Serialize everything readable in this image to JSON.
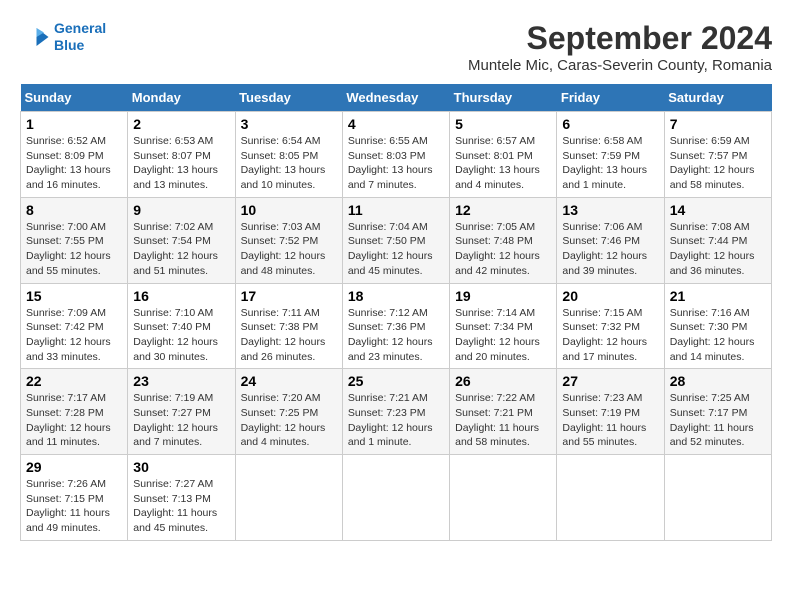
{
  "logo": {
    "line1": "General",
    "line2": "Blue"
  },
  "title": "September 2024",
  "subtitle": "Muntele Mic, Caras-Severin County, Romania",
  "days_of_week": [
    "Sunday",
    "Monday",
    "Tuesday",
    "Wednesday",
    "Thursday",
    "Friday",
    "Saturday"
  ],
  "weeks": [
    [
      {
        "day": "1",
        "info": "Sunrise: 6:52 AM\nSunset: 8:09 PM\nDaylight: 13 hours\nand 16 minutes."
      },
      {
        "day": "2",
        "info": "Sunrise: 6:53 AM\nSunset: 8:07 PM\nDaylight: 13 hours\nand 13 minutes."
      },
      {
        "day": "3",
        "info": "Sunrise: 6:54 AM\nSunset: 8:05 PM\nDaylight: 13 hours\nand 10 minutes."
      },
      {
        "day": "4",
        "info": "Sunrise: 6:55 AM\nSunset: 8:03 PM\nDaylight: 13 hours\nand 7 minutes."
      },
      {
        "day": "5",
        "info": "Sunrise: 6:57 AM\nSunset: 8:01 PM\nDaylight: 13 hours\nand 4 minutes."
      },
      {
        "day": "6",
        "info": "Sunrise: 6:58 AM\nSunset: 7:59 PM\nDaylight: 13 hours\nand 1 minute."
      },
      {
        "day": "7",
        "info": "Sunrise: 6:59 AM\nSunset: 7:57 PM\nDaylight: 12 hours\nand 58 minutes."
      }
    ],
    [
      {
        "day": "8",
        "info": "Sunrise: 7:00 AM\nSunset: 7:55 PM\nDaylight: 12 hours\nand 55 minutes."
      },
      {
        "day": "9",
        "info": "Sunrise: 7:02 AM\nSunset: 7:54 PM\nDaylight: 12 hours\nand 51 minutes."
      },
      {
        "day": "10",
        "info": "Sunrise: 7:03 AM\nSunset: 7:52 PM\nDaylight: 12 hours\nand 48 minutes."
      },
      {
        "day": "11",
        "info": "Sunrise: 7:04 AM\nSunset: 7:50 PM\nDaylight: 12 hours\nand 45 minutes."
      },
      {
        "day": "12",
        "info": "Sunrise: 7:05 AM\nSunset: 7:48 PM\nDaylight: 12 hours\nand 42 minutes."
      },
      {
        "day": "13",
        "info": "Sunrise: 7:06 AM\nSunset: 7:46 PM\nDaylight: 12 hours\nand 39 minutes."
      },
      {
        "day": "14",
        "info": "Sunrise: 7:08 AM\nSunset: 7:44 PM\nDaylight: 12 hours\nand 36 minutes."
      }
    ],
    [
      {
        "day": "15",
        "info": "Sunrise: 7:09 AM\nSunset: 7:42 PM\nDaylight: 12 hours\nand 33 minutes."
      },
      {
        "day": "16",
        "info": "Sunrise: 7:10 AM\nSunset: 7:40 PM\nDaylight: 12 hours\nand 30 minutes."
      },
      {
        "day": "17",
        "info": "Sunrise: 7:11 AM\nSunset: 7:38 PM\nDaylight: 12 hours\nand 26 minutes."
      },
      {
        "day": "18",
        "info": "Sunrise: 7:12 AM\nSunset: 7:36 PM\nDaylight: 12 hours\nand 23 minutes."
      },
      {
        "day": "19",
        "info": "Sunrise: 7:14 AM\nSunset: 7:34 PM\nDaylight: 12 hours\nand 20 minutes."
      },
      {
        "day": "20",
        "info": "Sunrise: 7:15 AM\nSunset: 7:32 PM\nDaylight: 12 hours\nand 17 minutes."
      },
      {
        "day": "21",
        "info": "Sunrise: 7:16 AM\nSunset: 7:30 PM\nDaylight: 12 hours\nand 14 minutes."
      }
    ],
    [
      {
        "day": "22",
        "info": "Sunrise: 7:17 AM\nSunset: 7:28 PM\nDaylight: 12 hours\nand 11 minutes."
      },
      {
        "day": "23",
        "info": "Sunrise: 7:19 AM\nSunset: 7:27 PM\nDaylight: 12 hours\nand 7 minutes."
      },
      {
        "day": "24",
        "info": "Sunrise: 7:20 AM\nSunset: 7:25 PM\nDaylight: 12 hours\nand 4 minutes."
      },
      {
        "day": "25",
        "info": "Sunrise: 7:21 AM\nSunset: 7:23 PM\nDaylight: 12 hours\nand 1 minute."
      },
      {
        "day": "26",
        "info": "Sunrise: 7:22 AM\nSunset: 7:21 PM\nDaylight: 11 hours\nand 58 minutes."
      },
      {
        "day": "27",
        "info": "Sunrise: 7:23 AM\nSunset: 7:19 PM\nDaylight: 11 hours\nand 55 minutes."
      },
      {
        "day": "28",
        "info": "Sunrise: 7:25 AM\nSunset: 7:17 PM\nDaylight: 11 hours\nand 52 minutes."
      }
    ],
    [
      {
        "day": "29",
        "info": "Sunrise: 7:26 AM\nSunset: 7:15 PM\nDaylight: 11 hours\nand 49 minutes."
      },
      {
        "day": "30",
        "info": "Sunrise: 7:27 AM\nSunset: 7:13 PM\nDaylight: 11 hours\nand 45 minutes."
      },
      null,
      null,
      null,
      null,
      null
    ]
  ]
}
